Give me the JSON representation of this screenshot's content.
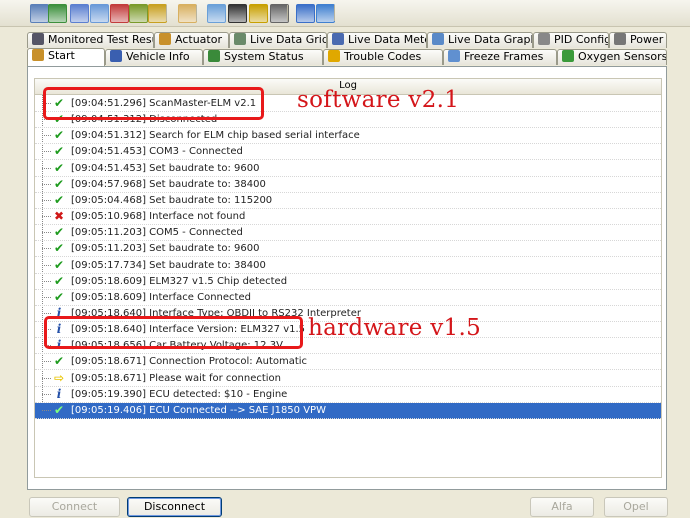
{
  "toolbar": {
    "icons": [
      "connect-icon",
      "globe-icon",
      "grid-icon",
      "chart-icon",
      "chart-bar-icon",
      "flags-icon",
      "dollar-icon",
      "clipboard-icon",
      "chat-icon",
      "terminal-icon",
      "battery-icon",
      "stop-icon",
      "info-icon",
      "help-icon"
    ]
  },
  "tabs_top": [
    {
      "label": "Monitored Test Results",
      "icon": "tests-icon"
    },
    {
      "label": "Actuator",
      "icon": "actuator-icon"
    },
    {
      "label": "Live Data Grid",
      "icon": "grid-icon"
    },
    {
      "label": "Live Data Meter",
      "icon": "meter-icon"
    },
    {
      "label": "Live Data Graph",
      "icon": "graph-icon"
    },
    {
      "label": "PID Config",
      "icon": "pid-icon"
    },
    {
      "label": "Power",
      "icon": "power-icon"
    }
  ],
  "tabs_bottom": [
    {
      "label": "Start",
      "icon": "home-icon",
      "active": true
    },
    {
      "label": "Vehicle Info",
      "icon": "info-icon"
    },
    {
      "label": "System Status",
      "icon": "status-icon"
    },
    {
      "label": "Trouble Codes",
      "icon": "warning-icon"
    },
    {
      "label": "Freeze Frames",
      "icon": "freeze-icon"
    },
    {
      "label": "Oxygen Sensors",
      "icon": "oxygen-icon"
    }
  ],
  "log": {
    "title": "Log",
    "entries": [
      {
        "status": "ok",
        "text": "[09:04:51.296] ScanMaster-ELM v2.1"
      },
      {
        "status": "ok",
        "text": "[09:04:51.312] Disconnected"
      },
      {
        "status": "ok",
        "text": "[09:04:51.312] Search for ELM chip based serial interface"
      },
      {
        "status": "ok",
        "text": "[09:04:51.453] COM3 - Connected"
      },
      {
        "status": "ok",
        "text": "[09:04:51.453] Set baudrate to: 9600"
      },
      {
        "status": "ok",
        "text": "[09:04:57.968] Set baudrate to: 38400"
      },
      {
        "status": "ok",
        "text": "[09:05:04.468] Set baudrate to: 115200"
      },
      {
        "status": "error",
        "text": "[09:05:10.968] Interface not found"
      },
      {
        "status": "ok",
        "text": "[09:05:11.203] COM5 - Connected"
      },
      {
        "status": "ok",
        "text": "[09:05:11.203] Set baudrate to: 9600"
      },
      {
        "status": "ok",
        "text": "[09:05:17.734] Set baudrate to: 38400"
      },
      {
        "status": "ok",
        "text": "[09:05:18.609] ELM327 v1.5 Chip detected"
      },
      {
        "status": "ok",
        "text": "[09:05:18.609] Interface Connected"
      },
      {
        "status": "info",
        "text": "[09:05:18.640] Interface Type: OBDII to RS232 Interpreter"
      },
      {
        "status": "info",
        "text": "[09:05:18.640] Interface Version: ELM327 v1.5"
      },
      {
        "status": "info",
        "text": "[09:05:18.656] Car Battery Voltage: 12.3V"
      },
      {
        "status": "ok",
        "text": "[09:05:18.671] Connection Protocol: Automatic"
      },
      {
        "status": "wait",
        "text": "[09:05:18.671] Please wait for connection"
      },
      {
        "status": "info",
        "text": "[09:05:19.390] ECU detected: $10 - Engine"
      },
      {
        "status": "ok",
        "text": "[09:05:19.406] ECU Connected --> SAE J1850 VPW",
        "selected": true
      }
    ]
  },
  "annotations": {
    "software": "software v2.1",
    "hardware": "hardware v1.5"
  },
  "buttons": {
    "connect": "Connect",
    "disconnect": "Disconnect",
    "alfa": "Alfa",
    "opel": "Opel"
  },
  "colors": {
    "accent": "#316ac5",
    "annotation_red": "#e8191a",
    "ok_green": "#1e9b1e",
    "error_red": "#d01818",
    "info_blue": "#2450a8",
    "wait_yellow": "#e8c400"
  }
}
